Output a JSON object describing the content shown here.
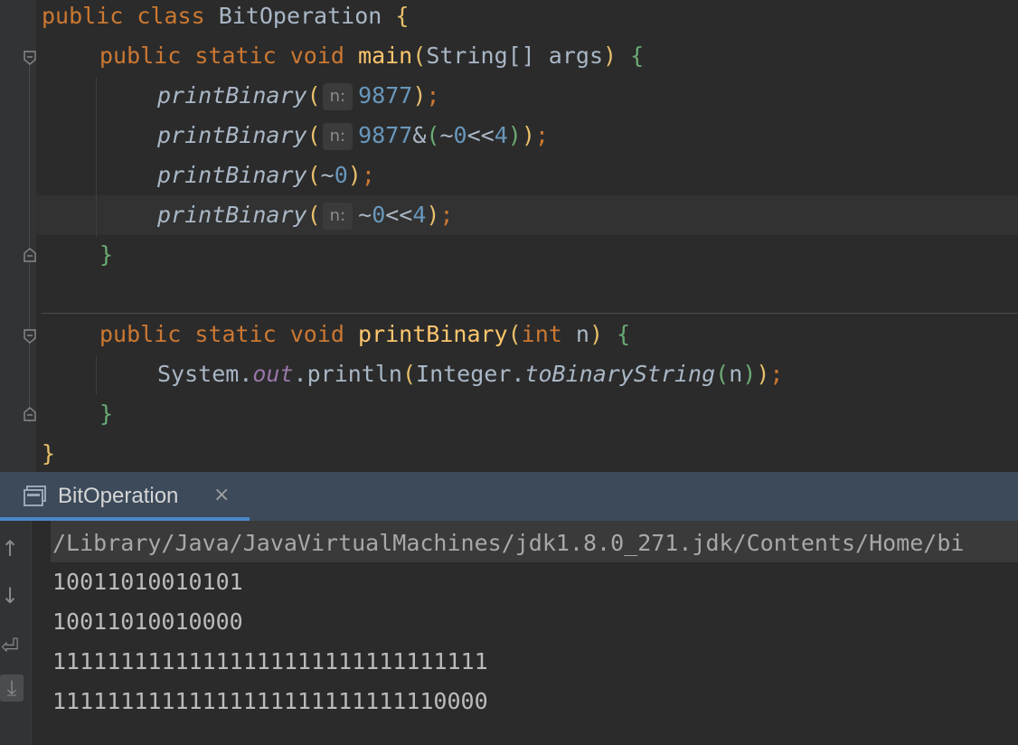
{
  "editor": {
    "lines": [
      {
        "id": "l1",
        "tokens": [
          "public",
          "class",
          "BitOperation",
          "{"
        ]
      },
      {
        "id": "l2",
        "tokens": [
          "public",
          "static",
          "void",
          "main",
          "(",
          "String[]",
          "args",
          ")",
          "{"
        ]
      }
    ],
    "class_decl": {
      "kw1": "public",
      "kw2": "class",
      "name": "BitOperation",
      "brace": "{"
    },
    "main_decl": {
      "kw1": "public",
      "kw2": "static",
      "kw3": "void",
      "name": "main",
      "lp": "(",
      "type": "String[]",
      "param": "args",
      "rp": ")",
      "brace": "{"
    },
    "call1": {
      "fn": "printBinary",
      "lp": "(",
      "hint": "n:",
      "arg": "9877",
      "rp": ")",
      "semi": ";"
    },
    "call2": {
      "fn": "printBinary",
      "lp": "(",
      "hint": "n:",
      "a": "9877",
      "amp": "&",
      "p1": "(",
      "tilde": "~",
      "zero": "0",
      "shift": "<<",
      "four": "4",
      "p2": ")",
      "rp": ")",
      "semi": ";"
    },
    "call3": {
      "fn": "printBinary",
      "lp": "(",
      "tilde": "~",
      "zero": "0",
      "rp": ")",
      "semi": ";"
    },
    "call4": {
      "fn": "printBinary",
      "lp": "(",
      "hint": "n:",
      "tilde": "~",
      "zero": "0",
      "shift": "<<",
      "four": "4",
      "rp": ")",
      "semi": ";"
    },
    "close_main": "}",
    "print_decl": {
      "kw1": "public",
      "kw2": "static",
      "kw3": "void",
      "name": "printBinary",
      "lp": "(",
      "type": "int",
      "param": "n",
      "rp": ")",
      "brace": "{"
    },
    "println": {
      "sys": "System",
      "dot1": ".",
      "out": "out",
      "dot2": ".",
      "method": "println",
      "lp": "(",
      "cls": "Integer",
      "dot3": ".",
      "call": "toBinaryString",
      "lp2": "(",
      "arg": "n",
      "rp2": ")",
      "rp": ")",
      "semi": ";"
    },
    "close_print": "}",
    "close_class": "}"
  },
  "run_panel": {
    "tab_label": "BitOperation",
    "close_glyph": "×",
    "command": "/Library/Java/JavaVirtualMachines/jdk1.8.0_271.jdk/Contents/Home/bi",
    "output": [
      "10011010010101",
      "10011010010000",
      "11111111111111111111111111111111",
      "11111111111111111111111111110000"
    ]
  },
  "toolbar": {
    "up_glyph": "↑",
    "down_glyph": "↓",
    "wrap_glyph": "⏎",
    "scroll_glyph": "⤓"
  },
  "colors": {
    "background": "#2b2b2b",
    "keyword": "#cc7832",
    "function": "#ffc66d",
    "number": "#6897bb",
    "field": "#9876aa",
    "tab_accent": "#4a88c7"
  }
}
